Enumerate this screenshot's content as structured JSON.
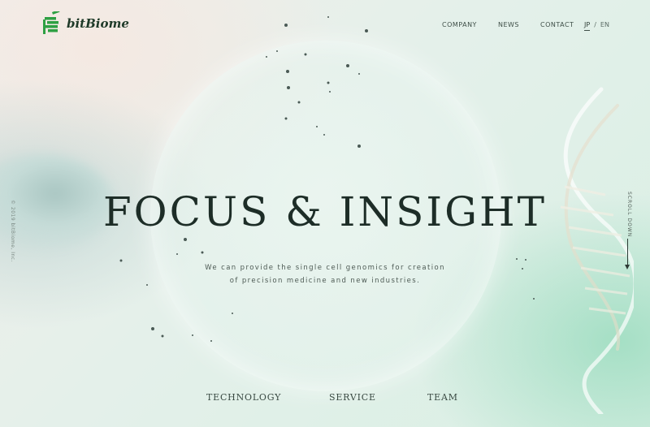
{
  "brand": {
    "name": "bitBiome",
    "logo_icon": "bitbiome-logo-icon",
    "accent": "#2ea043"
  },
  "nav": {
    "items": [
      "COMPANY",
      "NEWS",
      "CONTACT"
    ]
  },
  "lang": {
    "jp": "JP",
    "sep": "/",
    "en": "EN"
  },
  "hero": {
    "title": "FOCUS & INSIGHT",
    "subtitle_line1": "We can provide the single cell genomics for creation",
    "subtitle_line2": "of precision medicine and new industries."
  },
  "side": {
    "copyright": "© 2019 bitBiome, Inc.",
    "scroll": "SCROLL DOWN"
  },
  "bottom_nav": [
    "TECHNOLOGY",
    "SERVICE",
    "TEAM"
  ]
}
